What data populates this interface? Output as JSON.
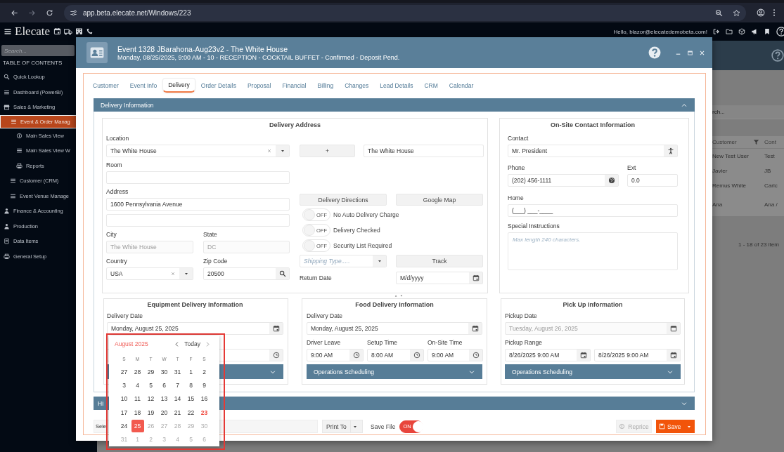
{
  "browser": {
    "url": "app.beta.elecate.net/Windows/223"
  },
  "app_header": {
    "logo": "Elecate",
    "greeting": "Hello, blazor@elecatedemobeta.com!"
  },
  "sidebar": {
    "search_placeholder": "Search...",
    "heading": "TABLE OF CONTENTS",
    "items": [
      {
        "label": "Quick Lookup",
        "selected": false
      },
      {
        "label": "Dashboard (PowerBI)",
        "selected": false
      },
      {
        "label": "Sales & Marketing",
        "selected": false,
        "children": [
          {
            "label": "Event & Order Manag",
            "selected": true,
            "children": [
              {
                "label": "Main Sales View",
                "selected": false
              },
              {
                "label": "Main Sales View W",
                "selected": false
              },
              {
                "label": "Reports",
                "selected": false
              }
            ]
          },
          {
            "label": "Customer (CRM)",
            "selected": false
          },
          {
            "label": "Event Venue Manage",
            "selected": false
          }
        ]
      },
      {
        "label": "Finance & Accounting",
        "selected": false
      },
      {
        "label": "Production",
        "selected": false
      },
      {
        "label": "Data Items",
        "selected": false
      },
      {
        "label": "General Setup",
        "selected": false
      }
    ]
  },
  "background": {
    "search_placeholder": "rch...",
    "columns": [
      "Customer",
      "Cont"
    ],
    "rows": [
      [
        "New Test User",
        "Test"
      ],
      [
        "Javier",
        "JB"
      ],
      [
        "Remus White",
        "Carlc"
      ],
      [
        "Ana",
        "Ana /"
      ]
    ],
    "pager": "1 - 18 of 23 item"
  },
  "modal": {
    "title": "Event 1328 JBarahona-Aug23v2 - The White House",
    "subtitle": "Monday, 08/25/2025, 9:00 AM - 10 - RECEPTION - COCKTAIL BUFFET - Confirmed - Deposit Pend.",
    "tabs": [
      {
        "label": "Customer",
        "selected": false
      },
      {
        "label": "Event Info",
        "selected": false
      },
      {
        "label": "Delivery",
        "selected": true
      },
      {
        "label": "Order Details",
        "selected": false
      },
      {
        "label": "Proposal",
        "selected": false
      },
      {
        "label": "Financial",
        "selected": false
      },
      {
        "label": "Billing",
        "selected": false
      },
      {
        "label": "Changes",
        "selected": false
      },
      {
        "label": "Lead Details",
        "selected": false
      },
      {
        "label": "CRM",
        "selected": false
      },
      {
        "label": "Calendar",
        "selected": false
      }
    ],
    "section": {
      "title": "Delivery Information",
      "expanded": true
    },
    "delivery_address": {
      "title": "Delivery Address",
      "location_label": "Location",
      "location": "The White House",
      "room_label": "Room",
      "address_label": "Address",
      "address_line_1": "1600 Pennsylvania Avenue",
      "city_label": "City",
      "city": {
        "value": "The White House",
        "disabled": true
      },
      "state_label": "State",
      "state": {
        "value": "DC",
        "disabled": true
      },
      "country_label": "Country",
      "country": "USA",
      "zip_label": "Zip Code",
      "zip": "20500",
      "add_button": "+",
      "venue_name": "The White House",
      "directions_button": "Delivery Directions",
      "map_button": "Google Map",
      "toggles": [
        {
          "label": "No Auto Delivery Charge",
          "on": false,
          "state_text": "OFF"
        },
        {
          "label": "Delivery Checked",
          "on": false,
          "state_text": "OFF"
        },
        {
          "label": "Security List Required",
          "on": false,
          "state_text": "OFF"
        }
      ],
      "shipping_type_placeholder": "Shipping Type.....",
      "track_button": "Track",
      "return_date_label": "Return Date",
      "return_date_placeholder": "M/d/yyyy"
    },
    "contact": {
      "title": "On-Site Contact Information",
      "contact_label": "Contact",
      "contact": "Mr. President",
      "phone_label": "Phone",
      "phone": "(202) 456-1111",
      "ext_label": "Ext",
      "ext": "0.0",
      "home_label": "Home",
      "home": "(___) ___-____",
      "instructions_label": "Special Instructions",
      "instructions_placeholder": "Max length 240 characters."
    },
    "equipment": {
      "title": "Equipment Delivery Information",
      "date_label": "Delivery Date",
      "date": "Monday, August 25, 2025",
      "operations": {
        "expanded": false
      }
    },
    "food": {
      "title": "Food Delivery Information",
      "date_label": "Delivery Date",
      "date": "Monday, August 25, 2025",
      "times": [
        {
          "label": "Driver Leave",
          "value": "9:00 AM"
        },
        {
          "label": "Setup Time",
          "value": "8:00 AM"
        },
        {
          "label": "On-Site Time",
          "value": "9:00 AM"
        }
      ],
      "operations": {
        "title": "Operations Scheduling",
        "expanded": false
      }
    },
    "pickup": {
      "title": "Pick Up Information",
      "date_label": "Pickup Date",
      "date": {
        "value": "Tuesday, August 26, 2025",
        "disabled": true
      },
      "range_label": "Pickup Range",
      "range": [
        "8/26/2025 9:00 AM",
        "8/26/2025 9:00 AM"
      ],
      "operations": {
        "title": "Operations Scheduling",
        "expanded": false
      }
    },
    "history": {
      "title": "Hi",
      "expanded": false
    },
    "footer": {
      "select_text": "Sele",
      "print_button": "Print To",
      "save_file_label": "Save File",
      "save_file": {
        "on": true,
        "state_text": "ON"
      },
      "reprice_button": {
        "label": "Reprice",
        "disabled": true
      },
      "save_button": "Save"
    }
  },
  "datepicker": {
    "month": "August 2025",
    "today_button": "Today",
    "weekdays": [
      "S",
      "M",
      "T",
      "W",
      "T",
      "F",
      "S"
    ],
    "weeks": [
      [
        {
          "day": "27",
          "muted": false,
          "today": false,
          "selected": false
        },
        {
          "day": "28",
          "muted": false,
          "today": false,
          "selected": false
        },
        {
          "day": "29",
          "muted": false,
          "today": false,
          "selected": false
        },
        {
          "day": "30",
          "muted": false,
          "today": false,
          "selected": false
        },
        {
          "day": "31",
          "muted": false,
          "today": false,
          "selected": false
        },
        {
          "day": "1",
          "muted": false,
          "today": false,
          "selected": false
        },
        {
          "day": "2",
          "muted": false,
          "today": false,
          "selected": false
        }
      ],
      [
        {
          "day": "3",
          "muted": false,
          "today": false,
          "selected": false
        },
        {
          "day": "4",
          "muted": false,
          "today": false,
          "selected": false
        },
        {
          "day": "5",
          "muted": false,
          "today": false,
          "selected": false
        },
        {
          "day": "6",
          "muted": false,
          "today": false,
          "selected": false
        },
        {
          "day": "7",
          "muted": false,
          "today": false,
          "selected": false
        },
        {
          "day": "8",
          "muted": false,
          "today": false,
          "selected": false
        },
        {
          "day": "9",
          "muted": false,
          "today": false,
          "selected": false
        }
      ],
      [
        {
          "day": "10",
          "muted": false,
          "today": false,
          "selected": false
        },
        {
          "day": "11",
          "muted": false,
          "today": false,
          "selected": false
        },
        {
          "day": "12",
          "muted": false,
          "today": false,
          "selected": false
        },
        {
          "day": "13",
          "muted": false,
          "today": false,
          "selected": false
        },
        {
          "day": "14",
          "muted": false,
          "today": false,
          "selected": false
        },
        {
          "day": "15",
          "muted": false,
          "today": false,
          "selected": false
        },
        {
          "day": "16",
          "muted": false,
          "today": false,
          "selected": false
        }
      ],
      [
        {
          "day": "17",
          "muted": false,
          "today": false,
          "selected": false
        },
        {
          "day": "18",
          "muted": false,
          "today": false,
          "selected": false
        },
        {
          "day": "19",
          "muted": false,
          "today": false,
          "selected": false
        },
        {
          "day": "20",
          "muted": false,
          "today": false,
          "selected": false
        },
        {
          "day": "21",
          "muted": false,
          "today": false,
          "selected": false
        },
        {
          "day": "22",
          "muted": false,
          "today": false,
          "selected": false
        },
        {
          "day": "23",
          "muted": false,
          "today": true,
          "selected": false
        }
      ],
      [
        {
          "day": "24",
          "muted": false,
          "today": false,
          "selected": false
        },
        {
          "day": "25",
          "muted": false,
          "today": false,
          "selected": true
        },
        {
          "day": "26",
          "muted": true,
          "today": false,
          "selected": false
        },
        {
          "day": "27",
          "muted": true,
          "today": false,
          "selected": false
        },
        {
          "day": "28",
          "muted": true,
          "today": false,
          "selected": false
        },
        {
          "day": "29",
          "muted": true,
          "today": false,
          "selected": false
        },
        {
          "day": "30",
          "muted": true,
          "today": false,
          "selected": false
        }
      ],
      [
        {
          "day": "31",
          "muted": true,
          "today": false,
          "selected": false
        },
        {
          "day": "1",
          "muted": true,
          "today": false,
          "selected": false
        },
        {
          "day": "2",
          "muted": true,
          "today": false,
          "selected": false
        },
        {
          "day": "3",
          "muted": true,
          "today": false,
          "selected": false
        },
        {
          "day": "4",
          "muted": true,
          "today": false,
          "selected": false
        },
        {
          "day": "5",
          "muted": true,
          "today": false,
          "selected": false
        },
        {
          "day": "6",
          "muted": true,
          "today": false,
          "selected": false
        }
      ]
    ]
  }
}
